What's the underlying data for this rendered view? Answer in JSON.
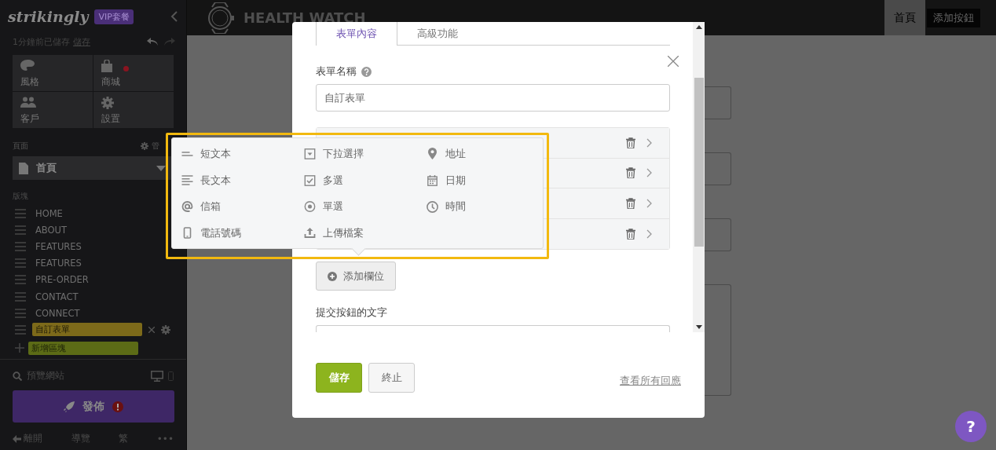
{
  "sidebar": {
    "logo": "strikingly",
    "plan_badge": "VIP套餐",
    "save_status": "1分鐘前已儲存",
    "save_link": "儲存",
    "tiles": [
      {
        "label": "風格",
        "kind": "palette",
        "notify": false
      },
      {
        "label": "商城",
        "kind": "store",
        "notify": true
      },
      {
        "label": "客戶",
        "kind": "people",
        "notify": false
      },
      {
        "label": "設置",
        "kind": "gear",
        "notify": false
      }
    ],
    "pages_label": "頁面",
    "manage_label": "管",
    "current_page": "首頁",
    "sections_label": "版塊",
    "sections": [
      {
        "label": "HOME",
        "kind": "plain"
      },
      {
        "label": "ABOUT",
        "kind": "plain"
      },
      {
        "label": "FEATURES",
        "kind": "plain"
      },
      {
        "label": "FEATURES",
        "kind": "plain"
      },
      {
        "label": "PRE-ORDER",
        "kind": "plain"
      },
      {
        "label": "CONTACT",
        "kind": "plain"
      },
      {
        "label": "CONNECT",
        "kind": "plain"
      },
      {
        "label": "自訂表單",
        "kind": "editing"
      },
      {
        "label": "新增區塊",
        "kind": "add"
      }
    ],
    "preview_label": "預覽網站",
    "publish_label": "發佈",
    "footer": [
      "離開",
      "導覽",
      "繁",
      "•••"
    ]
  },
  "help_label": "?",
  "site": {
    "title": "HEALTH WATCH",
    "nav": [
      {
        "label": "首頁",
        "kind": "link"
      },
      {
        "label": "添加按鈕",
        "kind": "button"
      }
    ]
  },
  "modal": {
    "tabs": [
      {
        "label": "表單內容",
        "selected": true
      },
      {
        "label": "高級功能",
        "selected": false
      }
    ],
    "name_label": "表單名稱",
    "name_value": "自訂表單",
    "field_rows": [
      {
        "kind": "field"
      },
      {
        "kind": "field"
      },
      {
        "kind": "field"
      },
      {
        "kind": "field"
      }
    ],
    "add_field": "添加欄位",
    "submit_label": "提交按鈕的文字",
    "save": "儲存",
    "cancel": "終止",
    "responses_link": "查看所有回應"
  },
  "field_menu": {
    "options": [
      {
        "label": "短文本",
        "kind": "short-text"
      },
      {
        "label": "下拉選擇",
        "kind": "dropdown"
      },
      {
        "label": "地址",
        "kind": "address"
      },
      {
        "label": "長文本",
        "kind": "long-text"
      },
      {
        "label": "多選",
        "kind": "checkbox"
      },
      {
        "label": "日期",
        "kind": "date"
      },
      {
        "label": "信箱",
        "kind": "email"
      },
      {
        "label": "單選",
        "kind": "radio"
      },
      {
        "label": "時間",
        "kind": "time"
      },
      {
        "label": "電話號碼",
        "kind": "phone"
      },
      {
        "label": "上傳檔案",
        "kind": "upload"
      }
    ]
  }
}
